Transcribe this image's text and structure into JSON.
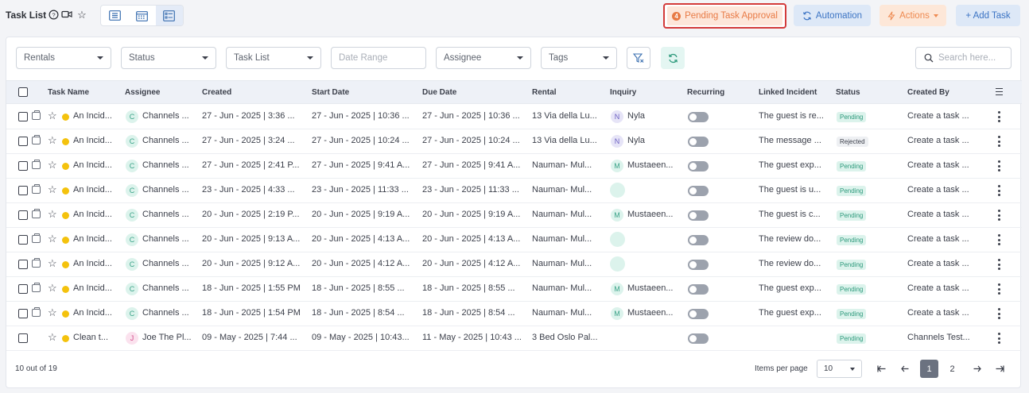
{
  "header": {
    "title": "Task List",
    "pending_approval": {
      "count": "4",
      "label": "Pending Task Approval"
    },
    "automation_label": "Automation",
    "actions_label": "Actions",
    "add_task_label": "+ Add Task"
  },
  "filters": {
    "rentals": "Rentals",
    "status": "Status",
    "task_list": "Task List",
    "date_range_placeholder": "Date Range",
    "assignee": "Assignee",
    "tags": "Tags",
    "search_placeholder": "Search here..."
  },
  "columns": [
    "Task Name",
    "Assignee",
    "Created",
    "Start Date",
    "Due Date",
    "Rental",
    "Inquiry",
    "Recurring",
    "Linked Incident",
    "Status",
    "Created By"
  ],
  "rows": [
    {
      "task": "An Incid...",
      "assignee_initial": "C",
      "assignee": "Channels ...",
      "created": "27 - Jun - 2025 | 3:36 ...",
      "start": "27 - Jun - 2025 | 10:36 ...",
      "due": "27 - Jun - 2025 | 10:36 ...",
      "rental": "13 Via della Lu...",
      "inquiry_initial": "N",
      "inquiry": "Nyla",
      "incident": "The guest is re...",
      "status": "Pending",
      "created_by": "Create a task ..."
    },
    {
      "task": "An Incid...",
      "assignee_initial": "C",
      "assignee": "Channels ...",
      "created": "27 - Jun - 2025 | 3:24 ...",
      "start": "27 - Jun - 2025 | 10:24 ...",
      "due": "27 - Jun - 2025 | 10:24 ...",
      "rental": "13 Via della Lu...",
      "inquiry_initial": "N",
      "inquiry": "Nyla",
      "incident": "The message ...",
      "status": "Rejected",
      "created_by": "Create a task ..."
    },
    {
      "task": "An Incid...",
      "assignee_initial": "C",
      "assignee": "Channels ...",
      "created": "27 - Jun - 2025 | 2:41 P...",
      "start": "27 - Jun - 2025 | 9:41 A...",
      "due": "27 - Jun - 2025 | 9:41 A...",
      "rental": "Nauman- Mul...",
      "inquiry_initial": "M",
      "inquiry": "Mustaeen...",
      "incident": "The guest exp...",
      "status": "Pending",
      "created_by": "Create a task ..."
    },
    {
      "task": "An Incid...",
      "assignee_initial": "C",
      "assignee": "Channels ...",
      "created": "23 - Jun - 2025 | 4:33 ...",
      "start": "23 - Jun - 2025 | 11:33 ...",
      "due": "23 - Jun - 2025 | 11:33 ...",
      "rental": "Nauman- Mul...",
      "inquiry_initial": "",
      "inquiry": "",
      "incident": "The guest is u...",
      "status": "Pending",
      "created_by": "Create a task ..."
    },
    {
      "task": "An Incid...",
      "assignee_initial": "C",
      "assignee": "Channels ...",
      "created": "20 - Jun - 2025 | 2:19 P...",
      "start": "20 - Jun - 2025 | 9:19 A...",
      "due": "20 - Jun - 2025 | 9:19 A...",
      "rental": "Nauman- Mul...",
      "inquiry_initial": "M",
      "inquiry": "Mustaeen...",
      "incident": "The guest is c...",
      "status": "Pending",
      "created_by": "Create a task ..."
    },
    {
      "task": "An Incid...",
      "assignee_initial": "C",
      "assignee": "Channels ...",
      "created": "20 - Jun - 2025 | 9:13 A...",
      "start": "20 - Jun - 2025 | 4:13 A...",
      "due": "20 - Jun - 2025 | 4:13 A...",
      "rental": "Nauman- Mul...",
      "inquiry_initial": "",
      "inquiry": "",
      "incident": "The review do...",
      "status": "Pending",
      "created_by": "Create a task ..."
    },
    {
      "task": "An Incid...",
      "assignee_initial": "C",
      "assignee": "Channels ...",
      "created": "20 - Jun - 2025 | 9:12 A...",
      "start": "20 - Jun - 2025 | 4:12 A...",
      "due": "20 - Jun - 2025 | 4:12 A...",
      "rental": "Nauman- Mul...",
      "inquiry_initial": "",
      "inquiry": "",
      "incident": "The review do...",
      "status": "Pending",
      "created_by": "Create a task ..."
    },
    {
      "task": "An Incid...",
      "assignee_initial": "C",
      "assignee": "Channels ...",
      "created": "18 - Jun - 2025 | 1:55 PM",
      "start": "18 - Jun - 2025 | 8:55 ...",
      "due": "18 - Jun - 2025 | 8:55 ...",
      "rental": "Nauman- Mul...",
      "inquiry_initial": "M",
      "inquiry": "Mustaeen...",
      "incident": "The guest exp...",
      "status": "Pending",
      "created_by": "Create a task ..."
    },
    {
      "task": "An Incid...",
      "assignee_initial": "C",
      "assignee": "Channels ...",
      "created": "18 - Jun - 2025 | 1:54 PM",
      "start": "18 - Jun - 2025 | 8:54 ...",
      "due": "18 - Jun - 2025 | 8:54 ...",
      "rental": "Nauman- Mul...",
      "inquiry_initial": "M",
      "inquiry": "Mustaeen...",
      "incident": "The guest exp...",
      "status": "Pending",
      "created_by": "Create a task ..."
    },
    {
      "task": "Clean t...",
      "assignee_initial": "J",
      "assignee": "Joe The Pl...",
      "created": "09 - May - 2025 | 7:44 ...",
      "start": "09 - May - 2025 | 10:43...",
      "due": "11 - May - 2025 | 10:43 ...",
      "rental": "3 Bed Oslo Pal...",
      "inquiry_initial": "",
      "inquiry": "",
      "incident": "",
      "status": "Pending",
      "created_by": "Channels Test..."
    }
  ],
  "footer": {
    "count_text": "10 out of 19",
    "items_per_page_label": "Items per page",
    "items_per_page_value": "10",
    "pages": [
      "1",
      "2"
    ]
  }
}
